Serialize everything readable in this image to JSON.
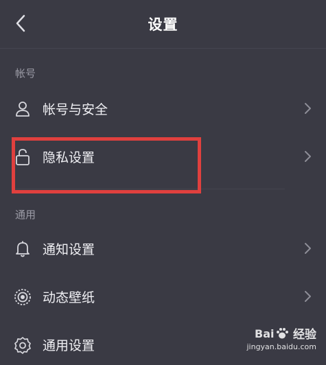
{
  "header": {
    "title": "设置",
    "back_icon": "chevron-left-icon"
  },
  "sections": [
    {
      "label": "帐号",
      "items": [
        {
          "label": "帐号与安全",
          "icon": "user-icon"
        },
        {
          "label": "隐私设置",
          "icon": "lock-icon"
        }
      ]
    },
    {
      "label": "通用",
      "items": [
        {
          "label": "通知设置",
          "icon": "bell-icon"
        },
        {
          "label": "动态壁纸",
          "icon": "wallpaper-icon"
        },
        {
          "label": "通用设置",
          "icon": "gear-icon"
        }
      ]
    }
  ],
  "highlight_color": "#e0403e",
  "watermark": {
    "brand": "经验",
    "url": "jingyan.baidu.com"
  }
}
